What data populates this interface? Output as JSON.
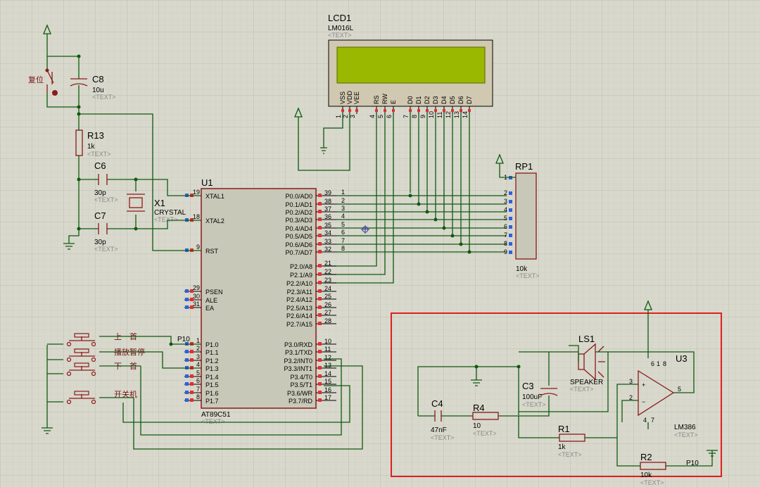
{
  "lcd": {
    "ref": "LCD1",
    "part": "LM016L",
    "text": "<TEXT>",
    "pins": [
      "VSS",
      "VDD",
      "VEE",
      "RS",
      "RW",
      "E",
      "D0",
      "D1",
      "D2",
      "D3",
      "D4",
      "D5",
      "D6",
      "D7"
    ],
    "nums": [
      "1",
      "2",
      "3",
      "4",
      "5",
      "6",
      "7",
      "8",
      "9",
      "10",
      "11",
      "12",
      "13",
      "14"
    ],
    "screen_color": "#9ab800"
  },
  "mcu": {
    "ref": "U1",
    "part": "AT89C51",
    "text": "<TEXT>",
    "left": [
      {
        "num": "19",
        "name": "XTAL1"
      },
      {
        "num": "18",
        "name": "XTAL2"
      },
      {
        "num": "9",
        "name": "RST"
      },
      {
        "num": "29",
        "name": "PSEN"
      },
      {
        "num": "30",
        "name": "ALE"
      },
      {
        "num": "31",
        "name": "EA"
      },
      {
        "num": "1",
        "name": "P1.0"
      },
      {
        "num": "2",
        "name": "P1.1"
      },
      {
        "num": "3",
        "name": "P1.2"
      },
      {
        "num": "4",
        "name": "P1.3"
      },
      {
        "num": "5",
        "name": "P1.4"
      },
      {
        "num": "6",
        "name": "P1.5"
      },
      {
        "num": "7",
        "name": "P1.6"
      },
      {
        "num": "8",
        "name": "P1.7"
      }
    ],
    "right": [
      {
        "num": "39",
        "name": "P0.0/AD0",
        "net": "1"
      },
      {
        "num": "38",
        "name": "P0.1/AD1",
        "net": "2"
      },
      {
        "num": "37",
        "name": "P0.2/AD2",
        "net": "3"
      },
      {
        "num": "36",
        "name": "P0.3/AD3",
        "net": "4"
      },
      {
        "num": "35",
        "name": "P0.4/AD4",
        "net": "5"
      },
      {
        "num": "34",
        "name": "P0.5/AD5",
        "net": "6"
      },
      {
        "num": "33",
        "name": "P0.6/AD6",
        "net": "7"
      },
      {
        "num": "32",
        "name": "P0.7/AD7",
        "net": "8"
      },
      {
        "num": "21",
        "name": "P2.0/A8"
      },
      {
        "num": "22",
        "name": "P2.1/A9"
      },
      {
        "num": "23",
        "name": "P2.2/A10"
      },
      {
        "num": "24",
        "name": "P2.3/A11"
      },
      {
        "num": "25",
        "name": "P2.4/A12"
      },
      {
        "num": "26",
        "name": "P2.5/A13"
      },
      {
        "num": "27",
        "name": "P2.6/A14"
      },
      {
        "num": "28",
        "name": "P2.7/A15"
      },
      {
        "num": "10",
        "name": "P3.0/RXD"
      },
      {
        "num": "11",
        "name": "P3.1/TXD"
      },
      {
        "num": "12",
        "name": "P3.2/INT0"
      },
      {
        "num": "13",
        "name": "P3.3/INT1"
      },
      {
        "num": "14",
        "name": "P3.4/T0"
      },
      {
        "num": "15",
        "name": "P3.5/T1"
      },
      {
        "num": "16",
        "name": "P3.6/WR"
      },
      {
        "num": "17",
        "name": "P3.7/RD"
      }
    ]
  },
  "rp1": {
    "ref": "RP1",
    "value": "10k",
    "text": "<TEXT>",
    "nums": [
      "1",
      "2",
      "3",
      "4",
      "5",
      "6",
      "7",
      "8",
      "9"
    ]
  },
  "c8": {
    "ref": "C8",
    "value": "10u",
    "text": "<TEXT>"
  },
  "reset_label": "复位",
  "r13": {
    "ref": "R13",
    "value": "1k",
    "text": "<TEXT>"
  },
  "c6": {
    "ref": "C6",
    "value": "30p",
    "text": "<TEXT>"
  },
  "c7": {
    "ref": "C7",
    "value": "30p",
    "text": "<TEXT>"
  },
  "x1": {
    "ref": "X1",
    "part": "CRYSTAL",
    "text": "<TEXT>"
  },
  "buttons": [
    "上一首",
    "播放暂停",
    "下一首",
    "开关机"
  ],
  "p10_label": "P10",
  "ls1": {
    "ref": "LS1",
    "part": "SPEAKER",
    "text": "<TEXT>"
  },
  "c3": {
    "ref": "C3",
    "value": "100uF",
    "text": "<TEXT>"
  },
  "c4": {
    "ref": "C4",
    "value": "47nF",
    "text": "<TEXT>"
  },
  "r4": {
    "ref": "R4",
    "value": "10",
    "text": "<TEXT>"
  },
  "r1": {
    "ref": "R1",
    "value": "1k",
    "text": "<TEXT>"
  },
  "r2": {
    "ref": "R2",
    "value": "10k",
    "text": "<TEXT>"
  },
  "u3": {
    "ref": "U3",
    "part": "LM386",
    "text": "<TEXT>",
    "pins": [
      "3",
      "2",
      "5",
      "6",
      "4",
      "7",
      "1",
      "8"
    ]
  },
  "colors": {
    "wire": "#0f5a0f",
    "body": "#8b1a1a",
    "box": "#e02020",
    "grid": "#c6c6ba"
  }
}
